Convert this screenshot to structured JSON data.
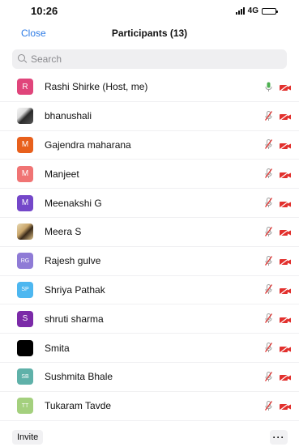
{
  "status_bar": {
    "time": "10:26",
    "network": "4G"
  },
  "header": {
    "close_label": "Close",
    "title": "Participants (13)"
  },
  "search": {
    "placeholder": "Search"
  },
  "participants": [
    {
      "name": "Rashi Shirke (Host, me)",
      "initials": "R",
      "avatar_color": "#e0457b",
      "avatar_type": "initials",
      "mic": "on",
      "video": "off"
    },
    {
      "name": "bhanushali",
      "initials": "",
      "avatar_color": "",
      "avatar_type": "photo",
      "mic": "muted",
      "video": "off"
    },
    {
      "name": "Gajendra maharana",
      "initials": "M",
      "avatar_color": "#e8601c",
      "avatar_type": "initials",
      "mic": "muted",
      "video": "off"
    },
    {
      "name": "Manjeet",
      "initials": "M",
      "avatar_color": "#f07474",
      "avatar_type": "initials",
      "mic": "muted",
      "video": "off"
    },
    {
      "name": "Meenakshi G",
      "initials": "M",
      "avatar_color": "#7447c9",
      "avatar_type": "initials",
      "mic": "muted",
      "video": "off"
    },
    {
      "name": "Meera S",
      "initials": "",
      "avatar_color": "",
      "avatar_type": "photo",
      "mic": "muted",
      "video": "off"
    },
    {
      "name": "Rajesh gulve",
      "initials": "RG",
      "avatar_color": "#8f7bd6",
      "avatar_type": "initials",
      "mic": "muted",
      "video": "off"
    },
    {
      "name": "Shriya Pathak",
      "initials": "SP",
      "avatar_color": "#4db7f0",
      "avatar_type": "initials",
      "mic": "muted",
      "video": "off"
    },
    {
      "name": "shruti sharma",
      "initials": "S",
      "avatar_color": "#7b2aa8",
      "avatar_type": "initials",
      "mic": "muted",
      "video": "off"
    },
    {
      "name": "Smita",
      "initials": "",
      "avatar_color": "#000000",
      "avatar_type": "initials",
      "mic": "muted",
      "video": "off"
    },
    {
      "name": "Sushmita Bhale",
      "initials": "SB",
      "avatar_color": "#5fb1a9",
      "avatar_type": "initials",
      "mic": "muted",
      "video": "off"
    },
    {
      "name": "Tukaram Tavde",
      "initials": "TT",
      "avatar_color": "#a4d07e",
      "avatar_type": "initials",
      "mic": "muted",
      "video": "off"
    }
  ],
  "footer": {
    "invite_label": "Invite",
    "more_label": "···"
  },
  "colors": {
    "accent": "#2d7be5",
    "muted_red": "#e2302d",
    "mic_on_green": "#4caf50"
  },
  "icons": {
    "mic_on": "microphone-icon",
    "mic_muted": "microphone-muted-icon",
    "video_off": "video-off-icon"
  }
}
